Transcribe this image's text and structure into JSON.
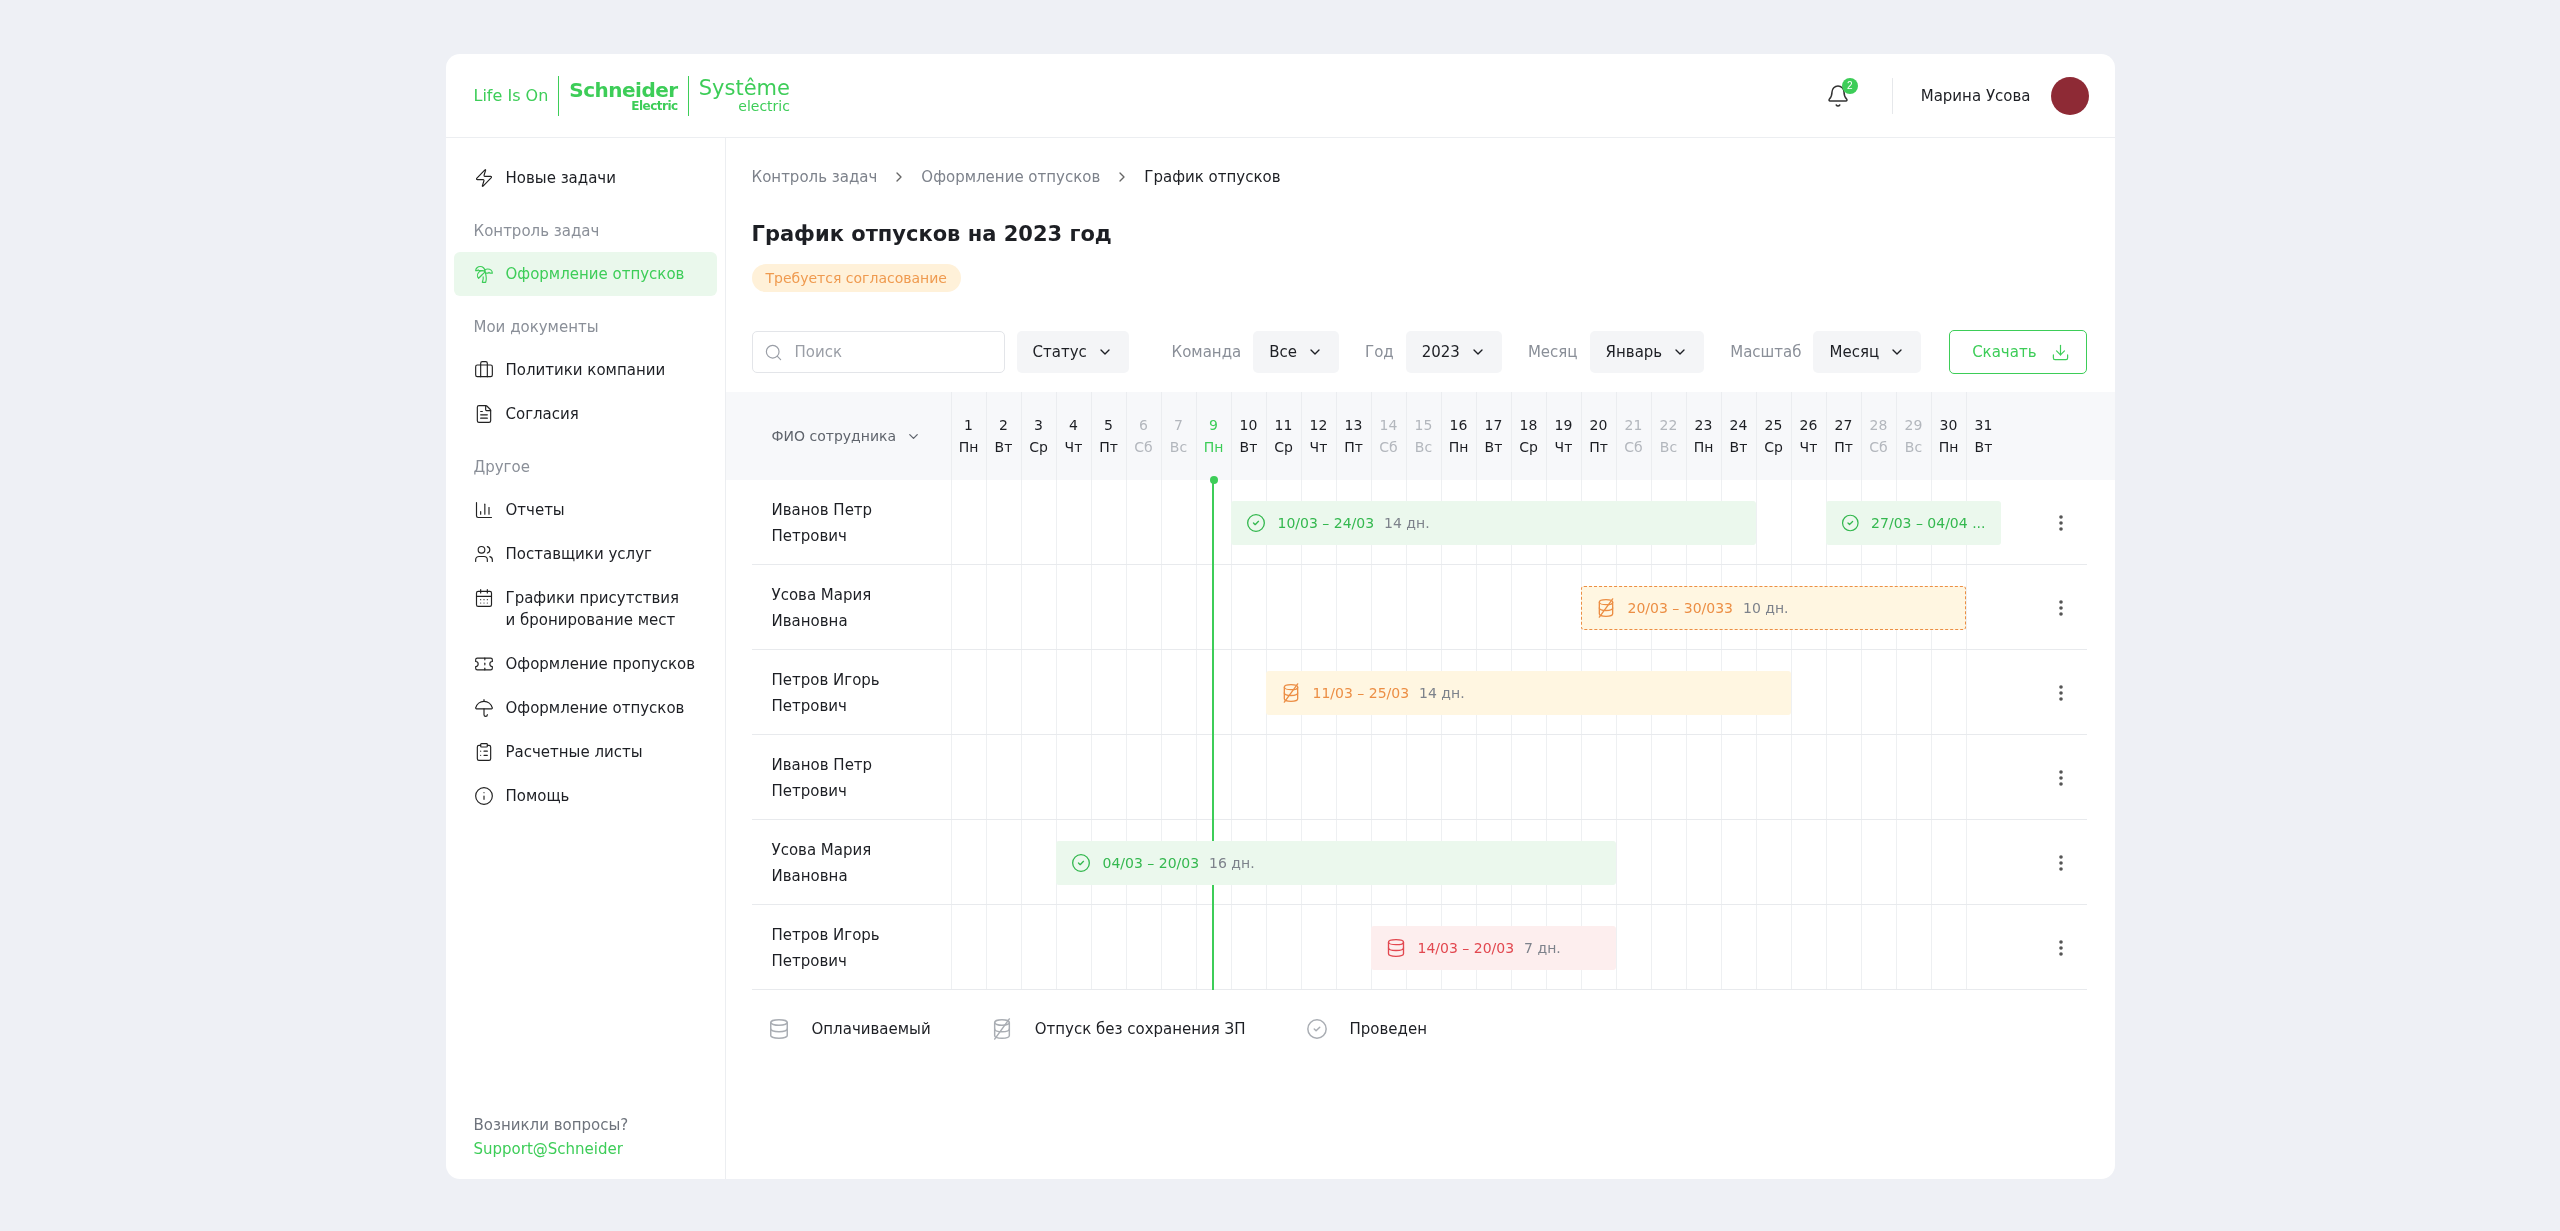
{
  "header": {
    "logo": {
      "tagline": "Life Is On",
      "brand": "Schneider",
      "brand_sub": "Electric",
      "partner": "Systême",
      "partner_sub": "electric"
    },
    "notifications": "2",
    "user": "Марина Усова"
  },
  "sidebar": {
    "sections": [
      {
        "items": [
          {
            "label": "Новые задачи",
            "selected": false
          }
        ]
      },
      {
        "title": "Контроль задач",
        "items": [
          {
            "label": "Оформление отпусков",
            "selected": true
          }
        ]
      },
      {
        "title": "Мои документы",
        "items": [
          {
            "label": "Политики компании",
            "selected": false
          },
          {
            "label": "Согласия",
            "selected": false
          }
        ]
      },
      {
        "title": "Другое",
        "items": [
          {
            "label": "Отчеты",
            "selected": false
          },
          {
            "label": "Поставщики услуг",
            "selected": false
          },
          {
            "label": "Графики присутствия\nи бронирование мест",
            "selected": false
          },
          {
            "label": "Оформление пропусков",
            "selected": false
          },
          {
            "label": "Оформление отпусков",
            "selected": false
          },
          {
            "label": "Расчетные листы",
            "selected": false
          },
          {
            "label": "Помощь",
            "selected": false
          }
        ]
      }
    ],
    "footer": {
      "question": "Возникли вопросы?",
      "link": "Support@Schneider"
    }
  },
  "breadcrumbs": [
    {
      "label": "Контроль задач",
      "current": false
    },
    {
      "label": "Оформление отпусков",
      "current": false
    },
    {
      "label": "График отпусков",
      "current": true
    }
  ],
  "title": "График отпусков на 2023 год",
  "status_badge": "Требуется согласование",
  "toolbar": {
    "search": {
      "placeholder": "Поиск"
    },
    "status": "Статус",
    "filters": [
      {
        "label": "Команда",
        "value": "Все"
      },
      {
        "label": "Год",
        "value": "2023"
      },
      {
        "label": "Месяц",
        "value": "Январь"
      },
      {
        "label": "Масштаб",
        "value": "Месяц"
      }
    ],
    "download": "Скачать"
  },
  "table": {
    "name_column": "ФИО сотрудника",
    "days": [
      {
        "num": "1",
        "dow": "Пн",
        "weekend": false,
        "today": false
      },
      {
        "num": "2",
        "dow": "Вт",
        "weekend": false,
        "today": false
      },
      {
        "num": "3",
        "dow": "Ср",
        "weekend": false,
        "today": false
      },
      {
        "num": "4",
        "dow": "Чт",
        "weekend": false,
        "today": false
      },
      {
        "num": "5",
        "dow": "Пт",
        "weekend": false,
        "today": false
      },
      {
        "num": "6",
        "dow": "Сб",
        "weekend": true,
        "today": false
      },
      {
        "num": "7",
        "dow": "Вс",
        "weekend": true,
        "today": false
      },
      {
        "num": "9",
        "dow": "Пн",
        "weekend": false,
        "today": true
      },
      {
        "num": "10",
        "dow": "Вт",
        "weekend": false,
        "today": false
      },
      {
        "num": "11",
        "dow": "Ср",
        "weekend": false,
        "today": false
      },
      {
        "num": "12",
        "dow": "Чт",
        "weekend": false,
        "today": false
      },
      {
        "num": "13",
        "dow": "Пт",
        "weekend": false,
        "today": false
      },
      {
        "num": "14",
        "dow": "Сб",
        "weekend": true,
        "today": false
      },
      {
        "num": "15",
        "dow": "Вс",
        "weekend": true,
        "today": false
      },
      {
        "num": "16",
        "dow": "Пн",
        "weekend": false,
        "today": false
      },
      {
        "num": "17",
        "dow": "Вт",
        "weekend": false,
        "today": false
      },
      {
        "num": "18",
        "dow": "Ср",
        "weekend": false,
        "today": false
      },
      {
        "num": "19",
        "dow": "Чт",
        "weekend": false,
        "today": false
      },
      {
        "num": "20",
        "dow": "Пт",
        "weekend": false,
        "today": false
      },
      {
        "num": "21",
        "dow": "Сб",
        "weekend": true,
        "today": false
      },
      {
        "num": "22",
        "dow": "Вс",
        "weekend": true,
        "today": false
      },
      {
        "num": "23",
        "dow": "Пн",
        "weekend": false,
        "today": false
      },
      {
        "num": "24",
        "dow": "Вт",
        "weekend": false,
        "today": false
      },
      {
        "num": "25",
        "dow": "Ср",
        "weekend": false,
        "today": false
      },
      {
        "num": "26",
        "dow": "Чт",
        "weekend": false,
        "today": false
      },
      {
        "num": "27",
        "dow": "Пт",
        "weekend": false,
        "today": false
      },
      {
        "num": "28",
        "dow": "Сб",
        "weekend": true,
        "today": false
      },
      {
        "num": "29",
        "dow": "Вс",
        "weekend": true,
        "today": false
      },
      {
        "num": "30",
        "dow": "Пн",
        "weekend": false,
        "today": false
      },
      {
        "num": "31",
        "dow": "Вт",
        "weekend": false,
        "today": false
      }
    ],
    "rows": [
      {
        "name": "Иванов Петр\nПетрович",
        "bars": [
          {
            "kind": "approved",
            "draft": false,
            "dates": "10/03 – 24/03",
            "duration": "14 дн."
          },
          {
            "kind": "approved",
            "draft": false,
            "dates": "27/03 – 04/04 ..."
          }
        ]
      },
      {
        "name": "Усова Мария\nИвановна",
        "bars": [
          {
            "kind": "unpaid",
            "draft": true,
            "dates": "20/03 – 30/033",
            "duration": "10 дн."
          }
        ]
      },
      {
        "name": "Петров Игорь\nПетрович",
        "bars": [
          {
            "kind": "unpaid",
            "draft": false,
            "dates": "11/03 – 25/03",
            "duration": "14 дн."
          }
        ]
      },
      {
        "name": "Иванов Петр\nПетрович",
        "bars": []
      },
      {
        "name": "Усова Мария\nИвановна",
        "bars": [
          {
            "kind": "approved",
            "draft": false,
            "dates": "04/03 – 20/03",
            "duration": "16 дн."
          }
        ]
      },
      {
        "name": "Петров Игорь\nПетрович",
        "bars": [
          {
            "kind": "paid",
            "draft": false,
            "dates": "14/03 – 20/03",
            "duration": "7 дн."
          }
        ]
      }
    ]
  },
  "legend": [
    {
      "kind": "paid",
      "label": "Оплачиваемый"
    },
    {
      "kind": "unpaid",
      "label": "Отпуск без сохранения ЗП"
    },
    {
      "kind": "done",
      "label": "Проведен"
    }
  ]
}
